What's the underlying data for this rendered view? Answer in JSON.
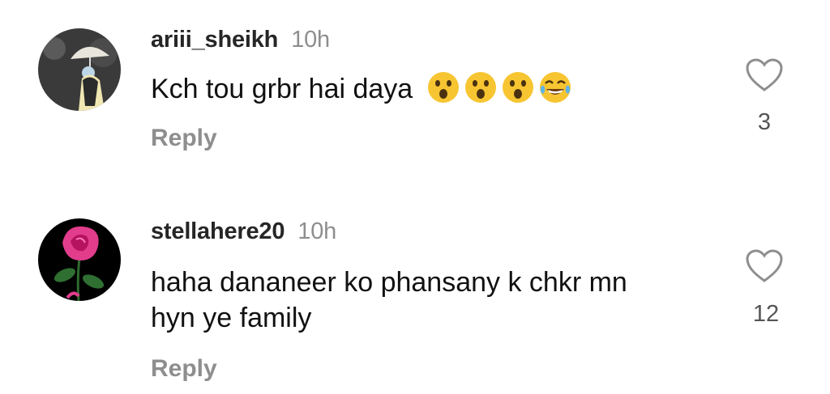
{
  "comments": [
    {
      "username": "ariii_sheikh",
      "time": "10h",
      "text": "Kch tou grbr hai daya",
      "emojis": [
        "surprised-face-emoji",
        "surprised-face-emoji",
        "surprised-face-emoji",
        "laughing-tears-emoji"
      ],
      "reply_label": "Reply",
      "like_count": "3"
    },
    {
      "username": "stellahere20",
      "time": "10h",
      "text_line1": "haha dananeer ko phansany k chkr mn",
      "text_line2": "hyn ye family",
      "reply_label": "Reply",
      "like_count": "12"
    }
  ]
}
